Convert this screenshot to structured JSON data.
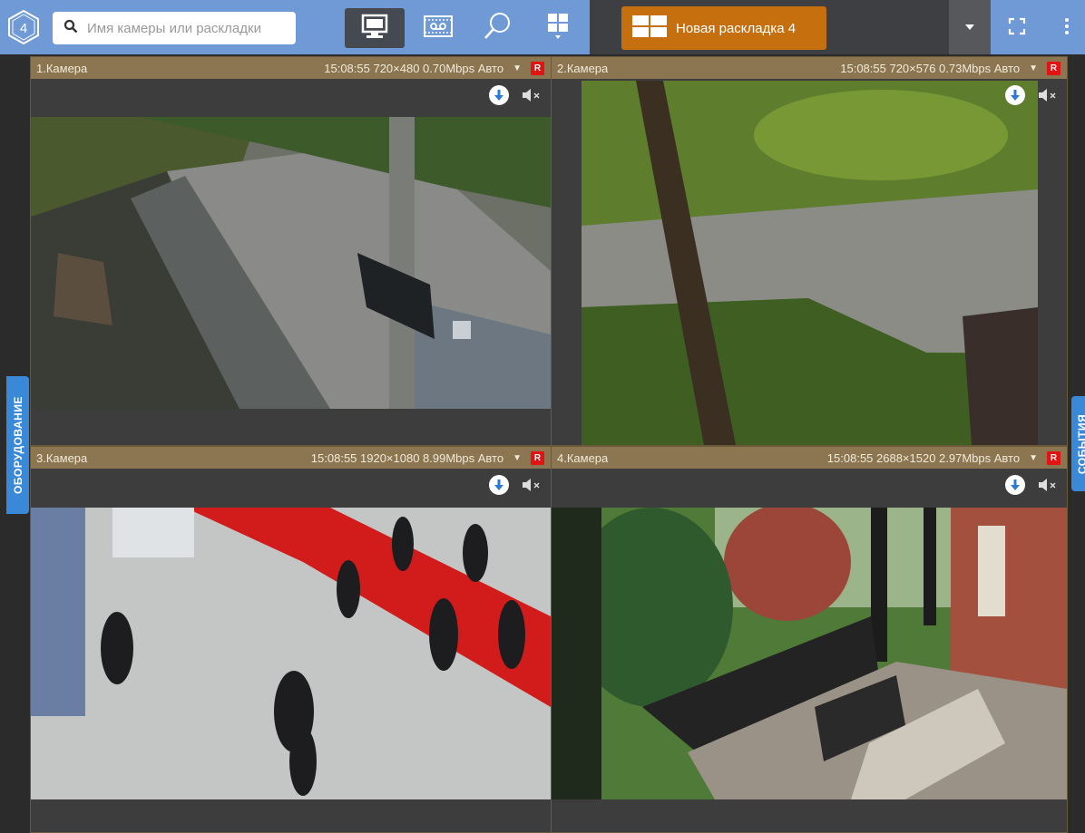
{
  "search": {
    "placeholder": "Имя камеры или раскладки"
  },
  "layout": {
    "label": "Новая раскладка 4"
  },
  "side_tabs": {
    "left": "ОБОРУДОВАНИЕ",
    "right": "СОБЫТИЯ"
  },
  "colors": {
    "topbar": "#6f9ad6",
    "layout_button": "#c66f0e",
    "tile_header": "#8b7651",
    "side_tab": "#3a88d8",
    "rec": "#e21313"
  },
  "cameras": [
    {
      "name": "1.Камера",
      "info": "15:08:55  720×480 0.70Mbps Авто",
      "rec": "R"
    },
    {
      "name": "2.Камера",
      "info": "15:08:55  720×576 0.73Mbps Авто",
      "rec": "R"
    },
    {
      "name": "3.Камера",
      "info": "15:08:55  1920×1080 8.99Mbps Авто",
      "rec": "R"
    },
    {
      "name": "4.Камера",
      "info": "15:08:55  2688×1520 2.97Mbps Авто",
      "rec": "R"
    }
  ],
  "icons": {
    "logo": "logo-icon",
    "search": "search-icon",
    "live": "monitor-icon",
    "archive": "archive-icon",
    "search_mode": "magnifier-icon",
    "layouts": "layouts-grid-icon",
    "layout": "layout-icon",
    "dropdown": "chevron-down-icon",
    "fullscreen": "fullscreen-icon",
    "more": "more-vertical-icon",
    "download": "download-icon",
    "mute": "speaker-mute-icon"
  }
}
